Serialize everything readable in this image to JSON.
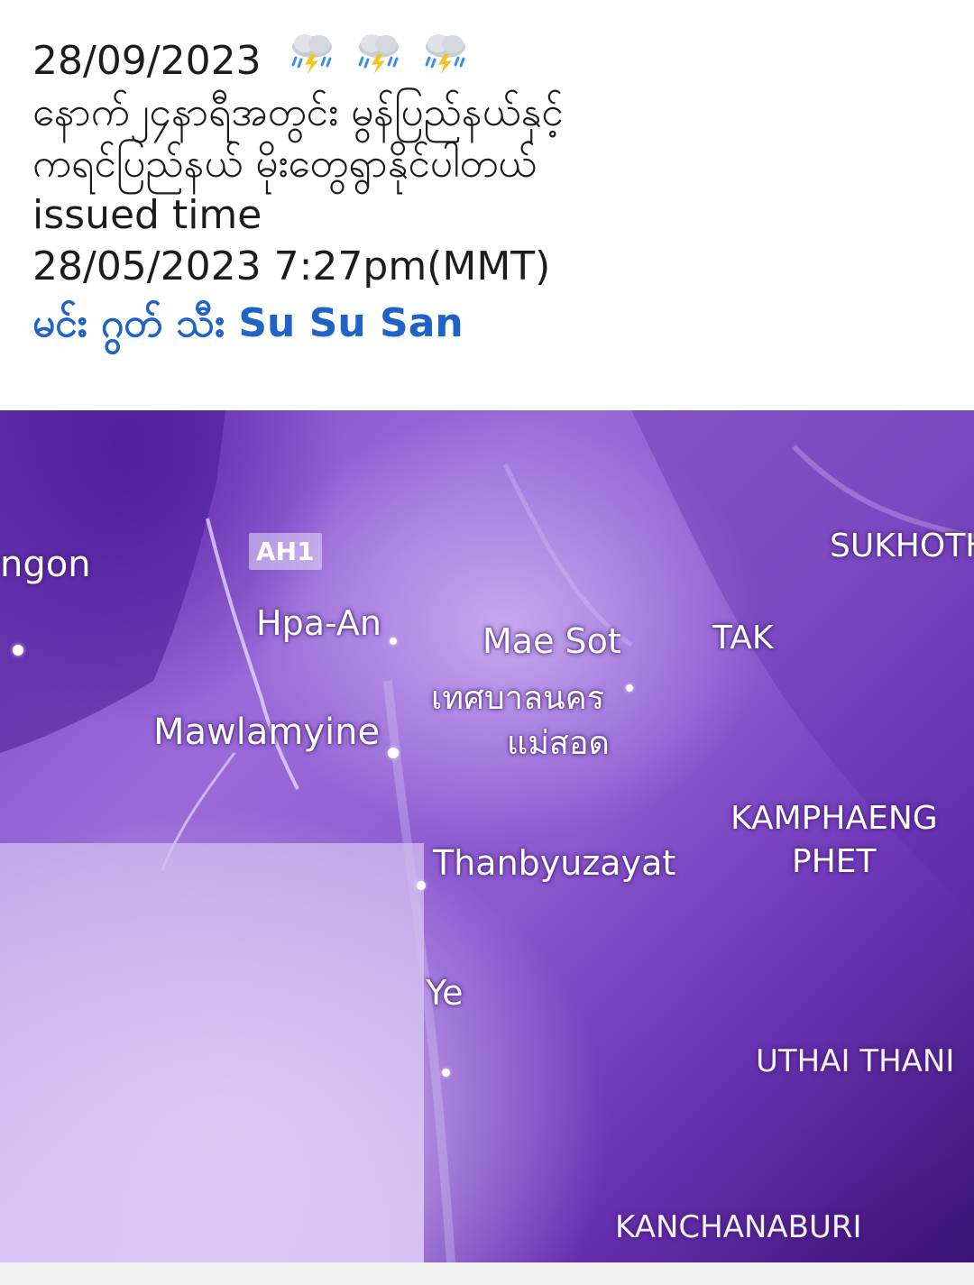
{
  "post": {
    "date": "28/09/2023",
    "weather_icons": [
      "thunderstorm-icon",
      "thunderstorm-icon",
      "thunderstorm-icon"
    ],
    "line1": "နောက်၂၄နာရီအတွင်း မွန်ပြည်နယ်နှင့်",
    "line2": "ကရင်ပြည်နယ် မိုးတွေရွာနိုင်ပါတယ်",
    "issued_label": "issued time",
    "issued_value": "28/05/2023 7:27pm(MMT)",
    "author": "မင်း ဂွတ် သီး Su Su San",
    "author_color": "#1f63c7"
  },
  "map": {
    "road_badge": "AH1",
    "places": {
      "yangon": "ngon",
      "hpa_an": "Hpa-An",
      "mawlamyine": "Mawlamyine",
      "mae_sot": "Mae Sot",
      "mae_sot_thai_1": "เทศบาลนคร",
      "mae_sot_thai_2": "แม่สอด",
      "tak": "TAK",
      "sukhothai": "SUKHOTH",
      "kamphaeng_1": "KAMPHAENG",
      "kamphaeng_2": "PHET",
      "thanbyuzayat": "Thanbyuzayat",
      "ye": "Ye",
      "uthai_thani": "UTHAI THANI",
      "kanchanaburi": "KANCHANABURI"
    },
    "colors": {
      "tint": "#7a46c6",
      "dark": "#2a0a52"
    }
  }
}
